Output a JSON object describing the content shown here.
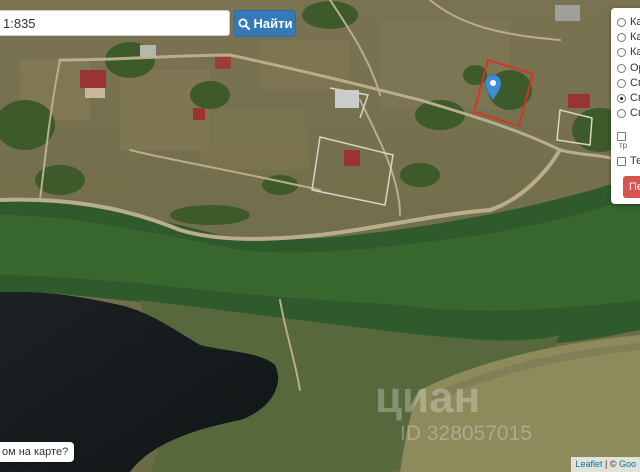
{
  "search": {
    "value": "1:835",
    "button_label": "Найти",
    "button_icon": "search-icon"
  },
  "layers": {
    "items": [
      {
        "label": "Ка",
        "selected": false
      },
      {
        "label": "Ка",
        "selected": false
      },
      {
        "label": "Ка",
        "selected": false
      },
      {
        "label": "Ор",
        "selected": false
      },
      {
        "label": "Сп",
        "selected": false
      },
      {
        "label": "Сп",
        "selected": true
      },
      {
        "label": "Сп",
        "selected": false
      }
    ],
    "checkbox1_label": "",
    "checkbox1_sub": "тр",
    "checkbox2_label": "Те",
    "red_button_label": "Пе"
  },
  "question_button": "ом на карте?",
  "attribution": {
    "leaflet": "Leaflet",
    "separator": " | © ",
    "provider": "Goo"
  },
  "watermark": {
    "brand": "циан",
    "id_line": "ID 328057015"
  },
  "colors": {
    "accent": "#337ab7",
    "parcel_outline": "#e0301e",
    "marker": "#3c8fd6",
    "danger": "#d9534f"
  }
}
